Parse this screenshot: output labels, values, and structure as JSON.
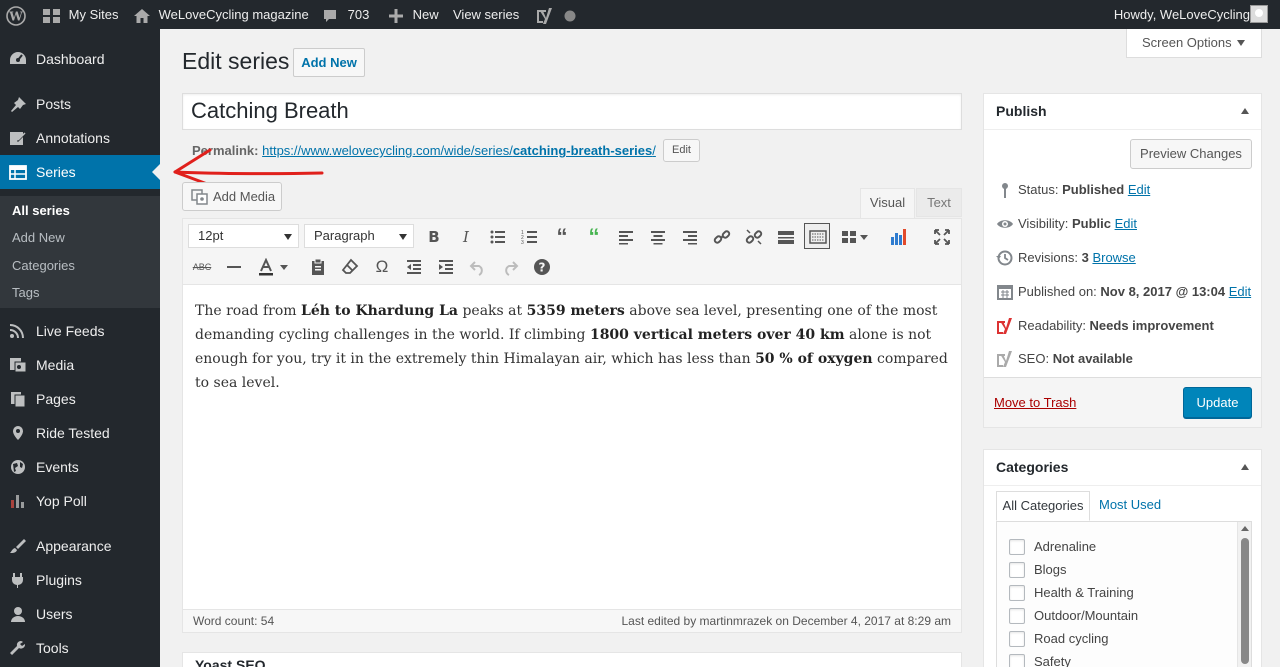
{
  "adminbar": {
    "my_sites": "My Sites",
    "site_name": "WeLoveCycling magazine",
    "comments_count": "703",
    "new_label": "New",
    "view_series": "View series",
    "howdy": "Howdy, WeLoveCycling"
  },
  "sidebar": {
    "items": [
      {
        "label": "Dashboard",
        "icon": "dashboard-icon"
      },
      {
        "label": "Posts",
        "icon": "pin-icon"
      },
      {
        "label": "Annotations",
        "icon": "annotation-icon"
      },
      {
        "label": "Series",
        "icon": "list-icon"
      },
      {
        "label": "Live Feeds",
        "icon": "rss-icon"
      },
      {
        "label": "Media",
        "icon": "media-icon"
      },
      {
        "label": "Pages",
        "icon": "pages-icon"
      },
      {
        "label": "Ride Tested",
        "icon": "location-icon"
      },
      {
        "label": "Events",
        "icon": "globe-icon"
      },
      {
        "label": "Yop Poll",
        "icon": "poll-icon"
      },
      {
        "label": "Appearance",
        "icon": "brush-icon"
      },
      {
        "label": "Plugins",
        "icon": "plugin-icon"
      },
      {
        "label": "Users",
        "icon": "user-icon"
      },
      {
        "label": "Tools",
        "icon": "wrench-icon"
      }
    ],
    "submenu": [
      "All series",
      "Add New",
      "Categories",
      "Tags"
    ]
  },
  "screen_options": "Screen Options",
  "page_title": "Edit series",
  "add_new": "Add New",
  "post_title": "Catching Breath",
  "permalink": {
    "label": "Permalink:",
    "url_base": "https://www.welovecycling.com/wide/series/",
    "slug": "catching-breath-series",
    "trailing": "/",
    "edit": "Edit"
  },
  "add_media": "Add Media",
  "editor_tabs": {
    "visual": "Visual",
    "text": "Text"
  },
  "toolbar": {
    "font_size": "12pt",
    "format": "Paragraph"
  },
  "content": {
    "p1": "The road from ",
    "b1": "Léh to Khardung La",
    "p2": " peaks at ",
    "b2": "5359 meters",
    "p3": " above sea level, presenting one of the most demanding cycling challenges in the world. If climbing ",
    "b3": "1800 vertical meters over 40 km",
    "p4": " alone is not enough for you, try it in the extremely thin Himalayan air, which has less than ",
    "b4": "50 % of oxygen",
    "p5": " compared to sea level."
  },
  "statusbar": {
    "word_count": "Word count: 54",
    "last_edited": "Last edited by martinmrazek on December 4, 2017 at 8:29 am"
  },
  "yoast_title": "Yoast SEO",
  "publish": {
    "title": "Publish",
    "preview": "Preview Changes",
    "status_label": "Status: ",
    "status_value": "Published",
    "visibility_label": "Visibility: ",
    "visibility_value": "Public",
    "revisions_label": "Revisions: ",
    "revisions_value": "3",
    "browse": "Browse",
    "published_label": "Published on: ",
    "published_value": "Nov 8, 2017 @ 13:04",
    "edit": "Edit",
    "readability_label": "Readability: ",
    "readability_value": "Needs improvement",
    "seo_label": "SEO: ",
    "seo_value": "Not available",
    "trash": "Move to Trash",
    "update": "Update"
  },
  "categories": {
    "title": "Categories",
    "tab_all": "All Categories",
    "tab_used": "Most Used",
    "items": [
      "Adrenaline",
      "Blogs",
      "Health & Training",
      "Outdoor/Mountain",
      "Road cycling",
      "Safety"
    ]
  },
  "colors": {
    "accent": "#0073aa",
    "sidebar": "#23282d",
    "annotation_arrow": "#e0201c"
  }
}
